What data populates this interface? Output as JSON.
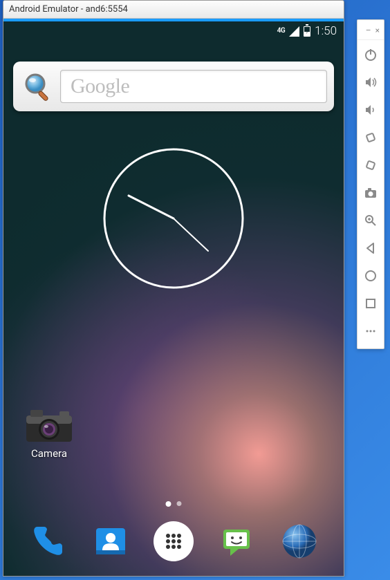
{
  "window": {
    "title": "Android Emulator - and6:5554"
  },
  "statusbar": {
    "network": "4G",
    "time": "1:50"
  },
  "search": {
    "placeholder": "Google"
  },
  "apps": {
    "camera_label": "Camera"
  },
  "dock": {
    "items": [
      "phone",
      "contacts",
      "apps",
      "messaging",
      "browser"
    ]
  },
  "toolbar": {
    "minimize": "–",
    "close": "×",
    "items": [
      "power",
      "volume-up",
      "volume-down",
      "rotate-left",
      "rotate-right",
      "screenshot",
      "zoom",
      "back",
      "home",
      "overview",
      "more"
    ]
  }
}
